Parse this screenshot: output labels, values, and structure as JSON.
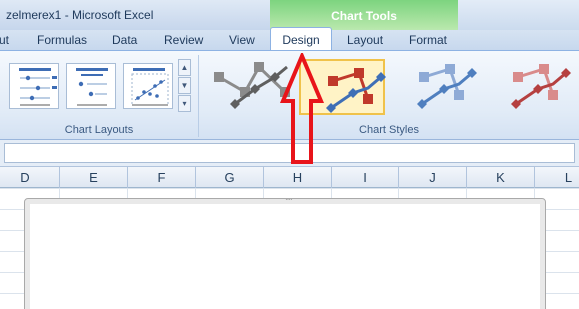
{
  "title": "zelmerex1  -  Microsoft Excel",
  "context_group": "Chart Tools",
  "tabs": [
    {
      "label": "ut"
    },
    {
      "label": "Formulas"
    },
    {
      "label": "Data"
    },
    {
      "label": "Review"
    },
    {
      "label": "View"
    },
    {
      "label": "Design",
      "active": true
    },
    {
      "label": "Layout"
    },
    {
      "label": "Format"
    }
  ],
  "groups": {
    "chart_layouts": "Chart Layouts",
    "chart_styles": "Chart Styles"
  },
  "columns": [
    "D",
    "E",
    "F",
    "G",
    "H",
    "I",
    "J",
    "K",
    "L"
  ],
  "annotation": {
    "color": "#e8141a",
    "icon": "up-arrow-outline"
  },
  "chart_styles": [
    {
      "name": "grayscale",
      "marker_color": "#8b8b8b",
      "line_color": "#5f5f5f"
    },
    {
      "name": "color",
      "marker_color": "#c0392b",
      "line_color": "#3f6fb6",
      "selected": true
    },
    {
      "name": "blue",
      "marker_color": "#8eaad6",
      "line_color": "#4f7fbf"
    },
    {
      "name": "red",
      "marker_color": "#d98b8b",
      "line_color": "#b54040"
    }
  ]
}
